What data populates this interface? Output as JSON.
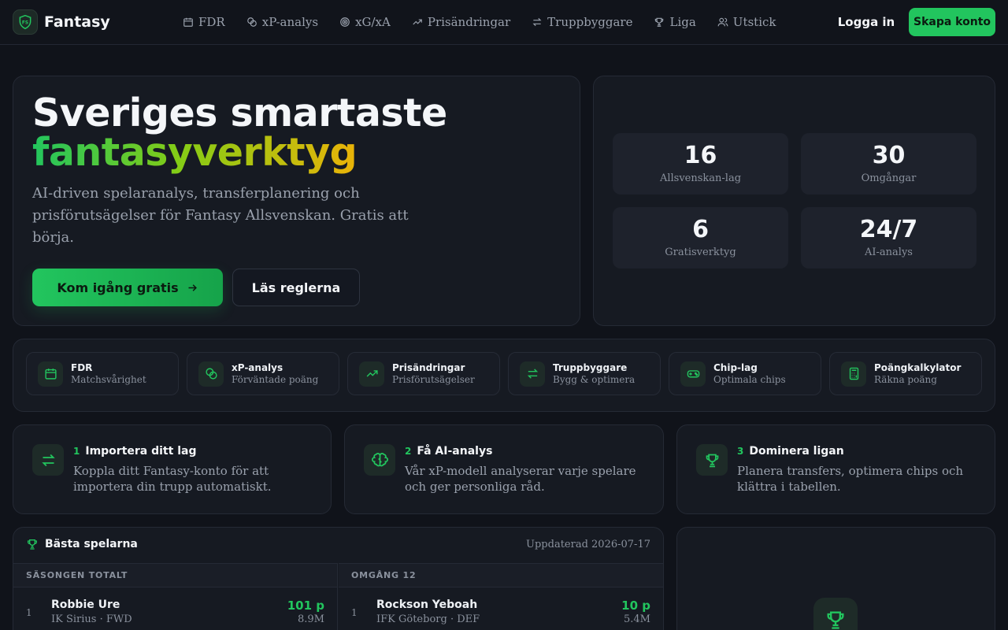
{
  "nav": {
    "brand": "Fantasy",
    "links": [
      {
        "label": "FDR",
        "icon": "calendar-icon"
      },
      {
        "label": "xP-analys",
        "icon": "coins-icon"
      },
      {
        "label": "xG/xA",
        "icon": "target-icon"
      },
      {
        "label": "Prisändringar",
        "icon": "trending-up-icon"
      },
      {
        "label": "Truppbyggare",
        "icon": "transfer-arrows-icon"
      },
      {
        "label": "Liga",
        "icon": "trophy-icon"
      },
      {
        "label": "Utstick",
        "icon": "users-icon"
      }
    ],
    "login": "Logga in",
    "signup": "Skapa konto"
  },
  "hero": {
    "title_line1": "Sveriges smartaste",
    "title_line2": "fantasyverktyg",
    "description": "AI-driven spelaranalys, transferplanering och prisförutsägelser för Fantasy Allsvenskan. Gratis att börja.",
    "cta_primary": "Kom igång gratis",
    "cta_secondary": "Läs reglerna"
  },
  "stats": [
    {
      "value": "16",
      "label": "Allsvenskan-lag"
    },
    {
      "value": "30",
      "label": "Omgångar"
    },
    {
      "value": "6",
      "label": "Gratisverktyg"
    },
    {
      "value": "24/7",
      "label": "AI-analys"
    }
  ],
  "tools": [
    {
      "name": "FDR",
      "sub": "Matchsvårighet",
      "icon": "calendar-icon"
    },
    {
      "name": "xP-analys",
      "sub": "Förväntade poäng",
      "icon": "coins-icon"
    },
    {
      "name": "Prisändringar",
      "sub": "Prisförutsägelser",
      "icon": "trending-up-icon"
    },
    {
      "name": "Truppbyggare",
      "sub": "Bygg & optimera",
      "icon": "transfer-arrows-icon"
    },
    {
      "name": "Chip-lag",
      "sub": "Optimala chips",
      "icon": "gamepad-icon"
    },
    {
      "name": "Poängkalkylator",
      "sub": "Räkna poäng",
      "icon": "calculator-icon"
    }
  ],
  "steps": [
    {
      "num": "1",
      "title": "Importera ditt lag",
      "desc": "Koppla ditt Fantasy-konto för att importera din trupp automatiskt.",
      "icon": "transfer-arrows-icon"
    },
    {
      "num": "2",
      "title": "Få AI-analys",
      "desc": "Vår xP-modell analyserar varje spelare och ger personliga råd.",
      "icon": "brain-icon"
    },
    {
      "num": "3",
      "title": "Dominera ligan",
      "desc": "Planera transfers, optimera chips och klättra i tabellen.",
      "icon": "trophy-icon"
    }
  ],
  "players": {
    "title": "Bästa spelarna",
    "updated": "Uppdaterad 2026-07-17",
    "season_header": "SÄSONGEN TOTALT",
    "round_header": "OMGÅNG 12",
    "season": [
      {
        "rank": "1",
        "name": "Robbie Ure",
        "meta": "IK Sirius · FWD",
        "points": "101 p",
        "price": "8.9M"
      }
    ],
    "round": [
      {
        "rank": "1",
        "name": "Rockson Yeboah",
        "meta": "IFK Göteborg · DEF",
        "points": "10 p",
        "price": "5.4M"
      }
    ]
  },
  "colors": {
    "accent": "#22c55e",
    "background": "#10131a",
    "card": "#161a22"
  }
}
